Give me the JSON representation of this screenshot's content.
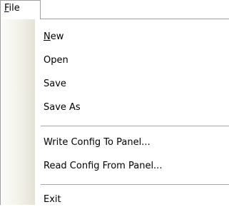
{
  "menubar": {
    "file_menu": {
      "label_accel": "F",
      "label_rest": "ile"
    }
  },
  "file_menu": {
    "items": [
      {
        "accel": "N",
        "rest": "ew"
      },
      {
        "label": "Open"
      },
      {
        "label": "Save"
      },
      {
        "label": "Save As"
      },
      {
        "label": "Write Config To Panel..."
      },
      {
        "label": "Read Config From Panel..."
      },
      {
        "label": "Exit"
      }
    ]
  }
}
